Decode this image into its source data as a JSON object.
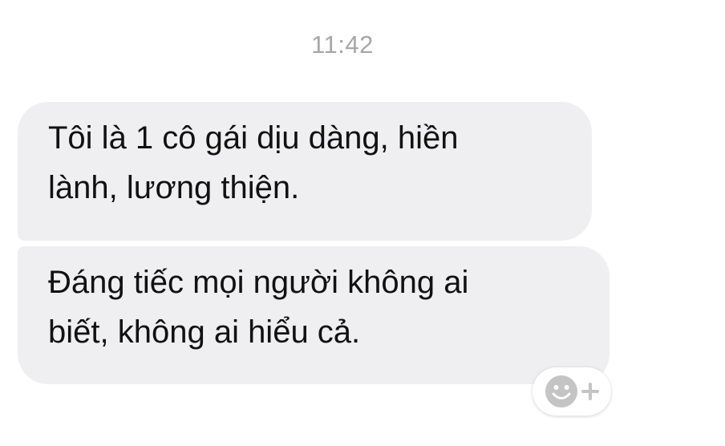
{
  "chat": {
    "timestamp": "11:42",
    "messages": [
      {
        "text": "Tôi là 1 cô gái dịu dàng, hiền\nlành, lương thiện."
      },
      {
        "text": "Đáng tiếc mọi người không ai\nbiết, không ai hiểu cả."
      }
    ],
    "reaction_icon": "add-reaction-icon",
    "colors": {
      "bubble_background": "#efeff1",
      "text": "#111111",
      "timestamp": "#a7a7a7",
      "reaction_icon": "#c4c4c4"
    }
  }
}
